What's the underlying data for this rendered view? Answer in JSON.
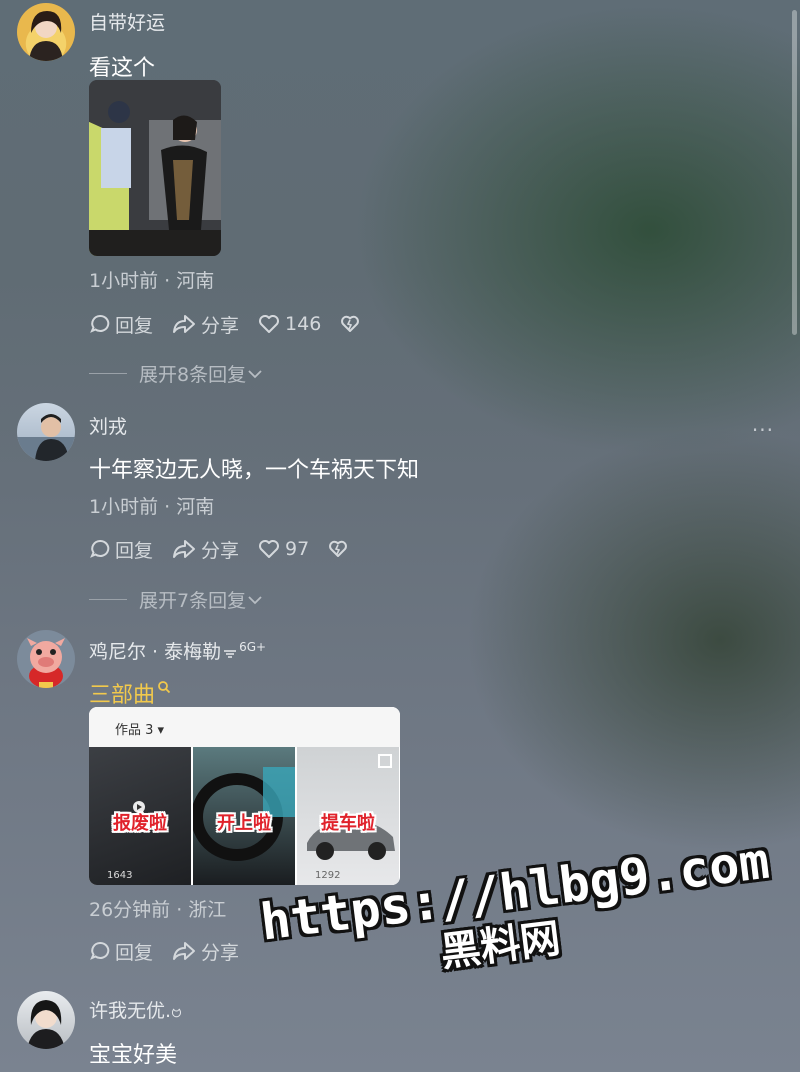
{
  "comments": [
    {
      "username": "自带好运",
      "text": "看这个",
      "meta": "1小时前 · 河南",
      "reply_label": "回复",
      "share_label": "分享",
      "likes": "146",
      "expand_label": "展开8条回复"
    },
    {
      "username": "刘戎",
      "text": "十年察边无人晓，一个车祸天下知",
      "meta": "1小时前 · 河南",
      "reply_label": "回复",
      "share_label": "分享",
      "likes": "97",
      "expand_label": "展开7条回复",
      "more_label": "···"
    },
    {
      "username": "鸡尼尔 · 泰梅勒",
      "username_tag": "6G+",
      "text": "三部曲",
      "meta": "26分钟前 · 浙江",
      "reply_label": "回复",
      "share_label": "分享",
      "card": {
        "header": "作品 3 ▾",
        "tiles": [
          {
            "label": "报废啦",
            "num": "1643"
          },
          {
            "label": "开上啦",
            "num": ""
          },
          {
            "label": "提车啦",
            "num": "1292"
          }
        ]
      }
    },
    {
      "username": "许我无优.",
      "username_suffix": "ဗ",
      "text": "宝宝好美"
    }
  ],
  "watermark": {
    "line1": "https://hlbg9.com",
    "line2": "黑料网"
  },
  "icons": {
    "reply": "comment-bubble-icon",
    "share": "share-arrow-icon",
    "like": "heart-icon",
    "dislike": "broken-heart-icon",
    "expand": "chevron-down-icon",
    "search": "search-icon"
  },
  "colors": {
    "highlight": "#f2c94c",
    "red_label": "#e0222b"
  }
}
